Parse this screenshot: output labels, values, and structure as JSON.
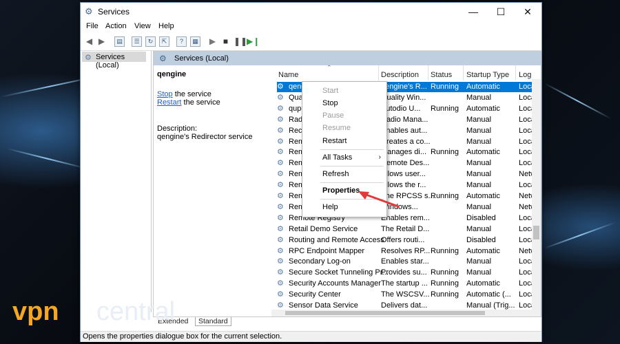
{
  "window": {
    "title": "Services",
    "controls": {
      "minimize": "—",
      "maximize": "☐",
      "close": "✕"
    }
  },
  "menu": [
    "File",
    "Action",
    "View",
    "Help"
  ],
  "tree": {
    "root_label": "Services (Local)"
  },
  "panel_header": "Services (Local)",
  "description_pane": {
    "service_name": "qengine",
    "stop_link": "Stop",
    "stop_suffix": " the service",
    "restart_link": "Restart",
    "restart_suffix": " the service",
    "description_label": "Description:",
    "description_text": "qengine's Redirector service"
  },
  "columns": [
    "Name",
    "Description",
    "Status",
    "Startup Type",
    "Log"
  ],
  "rows": [
    {
      "name": "qengine",
      "description": "qengine's R...",
      "status": "Running",
      "startup": "Automatic",
      "log": "Loca"
    },
    {
      "name": "Qual",
      "description": "Quality Win...",
      "status": "",
      "startup": "Manual",
      "log": "Loca"
    },
    {
      "name": "qupo",
      "description": "Autodio U...",
      "status": "Running",
      "startup": "Automatic",
      "log": "Loca"
    },
    {
      "name": "Radi",
      "description": "Radio Mana...",
      "status": "",
      "startup": "Manual",
      "log": "Loca"
    },
    {
      "name": "Reco",
      "description": "Enables aut...",
      "status": "",
      "startup": "Manual",
      "log": "Loca"
    },
    {
      "name": "Rem",
      "description": "Creates a co...",
      "status": "",
      "startup": "Manual",
      "log": "Loca"
    },
    {
      "name": "Rem",
      "description": "Manages di...",
      "status": "Running",
      "startup": "Automatic",
      "log": "Loca"
    },
    {
      "name": "Rem",
      "description": "Remote Des...",
      "status": "",
      "startup": "Manual",
      "log": "Loca"
    },
    {
      "name": "Rem",
      "description": "Allows user...",
      "status": "",
      "startup": "Manual",
      "log": "Netw"
    },
    {
      "name": "Rem",
      "description": "Allows the r...",
      "status": "",
      "startup": "Manual",
      "log": "Loca"
    },
    {
      "name": "Rem",
      "description": "The RPCSS s...",
      "status": "Running",
      "startup": "Automatic",
      "log": "Netw"
    },
    {
      "name": "Rem",
      "description": "Windows...",
      "status": "",
      "startup": "Manual",
      "log": "Netw"
    },
    {
      "name": "Remote Registry",
      "description": "Enables rem...",
      "status": "",
      "startup": "Disabled",
      "log": "Loca"
    },
    {
      "name": "Retail Demo Service",
      "description": "The Retail D...",
      "status": "",
      "startup": "Manual",
      "log": "Loca"
    },
    {
      "name": "Routing and Remote Access",
      "description": "Offers routi...",
      "status": "",
      "startup": "Disabled",
      "log": "Loca"
    },
    {
      "name": "RPC Endpoint Mapper",
      "description": "Resolves RP...",
      "status": "Running",
      "startup": "Automatic",
      "log": "Netw"
    },
    {
      "name": "Secondary Log-on",
      "description": "Enables star...",
      "status": "",
      "startup": "Manual",
      "log": "Loca"
    },
    {
      "name": "Secure Socket Tunneling Pr...",
      "description": "Provides su...",
      "status": "Running",
      "startup": "Manual",
      "log": "Loca"
    },
    {
      "name": "Security Accounts Manager",
      "description": "The startup ...",
      "status": "Running",
      "startup": "Automatic",
      "log": "Loca"
    },
    {
      "name": "Security Center",
      "description": "The WSCSV...",
      "status": "Running",
      "startup": "Automatic (...",
      "log": "Loca"
    },
    {
      "name": "Sensor Data Service",
      "description": "Delivers dat...",
      "status": "",
      "startup": "Manual (Trig...",
      "log": "Loca"
    }
  ],
  "context_menu": {
    "start": "Start",
    "stop": "Stop",
    "pause": "Pause",
    "resume": "Resume",
    "restart": "Restart",
    "all_tasks": "All Tasks",
    "refresh": "Refresh",
    "properties": "Properties",
    "help": "Help"
  },
  "tabs": [
    "Extended",
    "Standard"
  ],
  "status_bar": "Opens the properties dialogue box for the current selection.",
  "watermark": {
    "part1": "vpn",
    "part2": "central"
  },
  "colors": {
    "selection": "#0078d7",
    "arrow": "#e03a3a",
    "logo_orange": "#f5a623"
  }
}
